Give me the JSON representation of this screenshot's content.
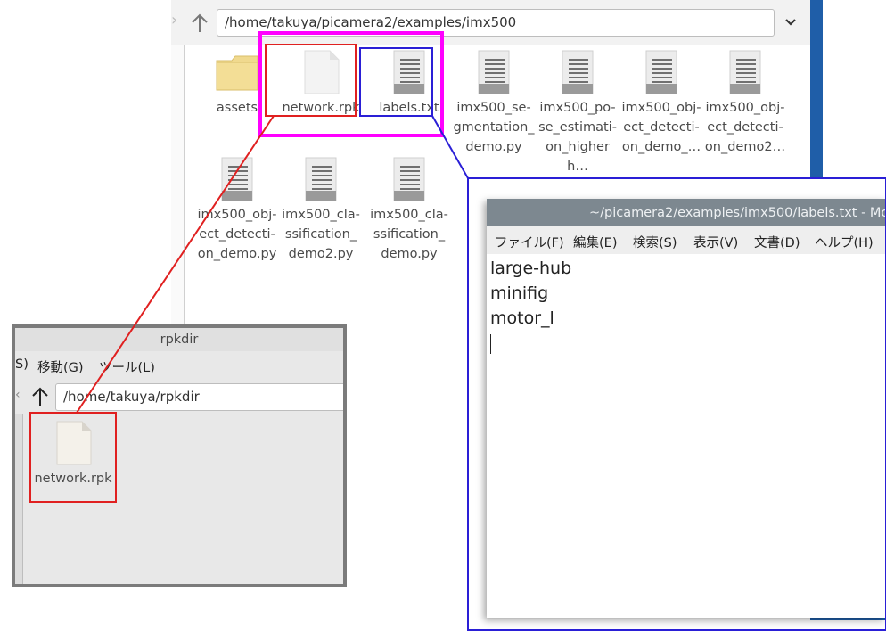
{
  "main_fm": {
    "path": "/home/takuya/picamera2/examples/imx500",
    "files_row1": [
      {
        "label": "assets",
        "type": "folder"
      },
      {
        "label": "network.rpk",
        "type": "blank"
      },
      {
        "label": "labels.txt",
        "type": "text"
      },
      {
        "label": "imx500_se- gmentation_ demo.py",
        "type": "text"
      },
      {
        "label": "imx500_po- se_estimati- on_higherh…",
        "type": "text"
      },
      {
        "label": "imx500_obj- ect_detecti- on_demo_…",
        "type": "text"
      },
      {
        "label": "imx500_obj- ect_detecti- on_demo2…",
        "type": "text"
      }
    ],
    "files_row2": [
      {
        "label": "imx500_obj- ect_detecti- on_demo.py",
        "type": "text"
      },
      {
        "label": "imx500_cla- ssification_ demo2.py",
        "type": "text"
      },
      {
        "label": "imx500_cla- ssification_ demo.py",
        "type": "text"
      }
    ]
  },
  "rpk_fm": {
    "title": "rpkdir",
    "menu_partial": "S)",
    "menu_go": "移動(G)",
    "menu_tools": "ツール(L)",
    "path": "/home/takuya/rpkdir",
    "file": "network.rpk"
  },
  "editor": {
    "title": "~/picamera2/examples/imx500/labels.txt - Mo",
    "menu": [
      "ファイル(F)",
      "編集(E)",
      "検索(S)",
      "表示(V)",
      "文書(D)",
      "ヘルプ(H)"
    ],
    "lines": [
      "large-hub",
      "minifig",
      "motor_l"
    ]
  },
  "colors": {
    "magenta": "#ff00ff",
    "red": "#e02020",
    "blue": "#2a1fd6",
    "desktop_blue": "#1f5ea8"
  }
}
